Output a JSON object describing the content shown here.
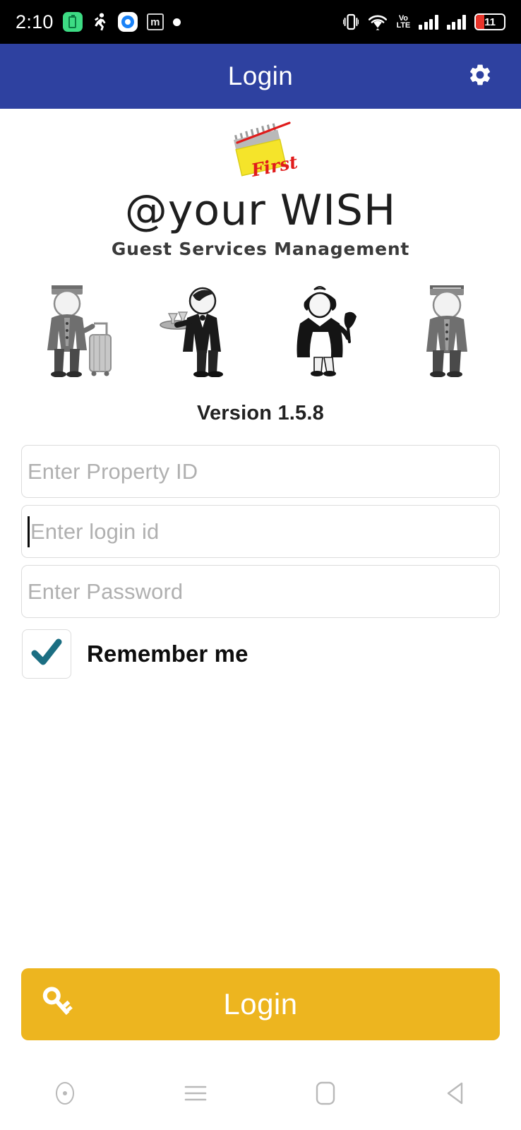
{
  "status_bar": {
    "time": "2:10",
    "battery_percent": "11",
    "left_icons": [
      {
        "name": "battery-saver-icon",
        "label": "battery-saver"
      },
      {
        "name": "activity-walk-icon",
        "label": "step-tracker"
      },
      {
        "name": "blue-circle-app-icon",
        "label": "app-notification"
      },
      {
        "name": "m-box-icon",
        "label": "m-app-notification"
      },
      {
        "name": "dot-icon",
        "label": "more-notifications"
      }
    ],
    "right_icons": [
      {
        "name": "vibrate-icon",
        "label": "vibrate-mode"
      },
      {
        "name": "wifi-icon",
        "label": "wifi"
      },
      {
        "name": "volte-icon",
        "label": "VoLTE"
      },
      {
        "name": "signal-sim1-icon",
        "label": "signal-sim-1"
      },
      {
        "name": "signal-sim2-icon",
        "label": "signal-sim-2"
      },
      {
        "name": "battery-icon",
        "label": "battery"
      }
    ],
    "volte_line1": "Vo",
    "volte_line2": "LTE"
  },
  "app_bar": {
    "title": "Login",
    "settings_icon": "gear-icon",
    "background_color": "#2e41a0",
    "text_color": "#ffffff"
  },
  "brand": {
    "logo_mark": "notepad-first-logo",
    "logo_mark_text": "First",
    "title": "@your WISH",
    "subtitle": "Guest Services Management",
    "illustration": "hotel-staff-illustration",
    "staff": [
      {
        "name": "bellhop-with-luggage"
      },
      {
        "name": "waiter-with-tray"
      },
      {
        "name": "maid-with-duster"
      },
      {
        "name": "porter-standing"
      }
    ]
  },
  "version": {
    "label": "Version 1.5.8"
  },
  "form": {
    "property_id": {
      "placeholder": "Enter Property ID",
      "value": "",
      "focused": false
    },
    "login_id": {
      "placeholder": "Enter login id",
      "value": "",
      "focused": true
    },
    "password": {
      "placeholder": "Enter Password",
      "value": "",
      "focused": false
    },
    "remember_me": {
      "label": "Remember me",
      "checked": true,
      "check_color": "#1b6e82"
    }
  },
  "login_button": {
    "label": "Login",
    "icon": "key-icon",
    "background_color": "#edb51f",
    "text_color": "#ffffff"
  },
  "nav_bar": {
    "items": [
      {
        "name": "screen-record-icon",
        "label": "screen-record"
      },
      {
        "name": "menu-icon",
        "label": "menu"
      },
      {
        "name": "home-icon",
        "label": "home"
      },
      {
        "name": "back-icon",
        "label": "back"
      }
    ]
  }
}
